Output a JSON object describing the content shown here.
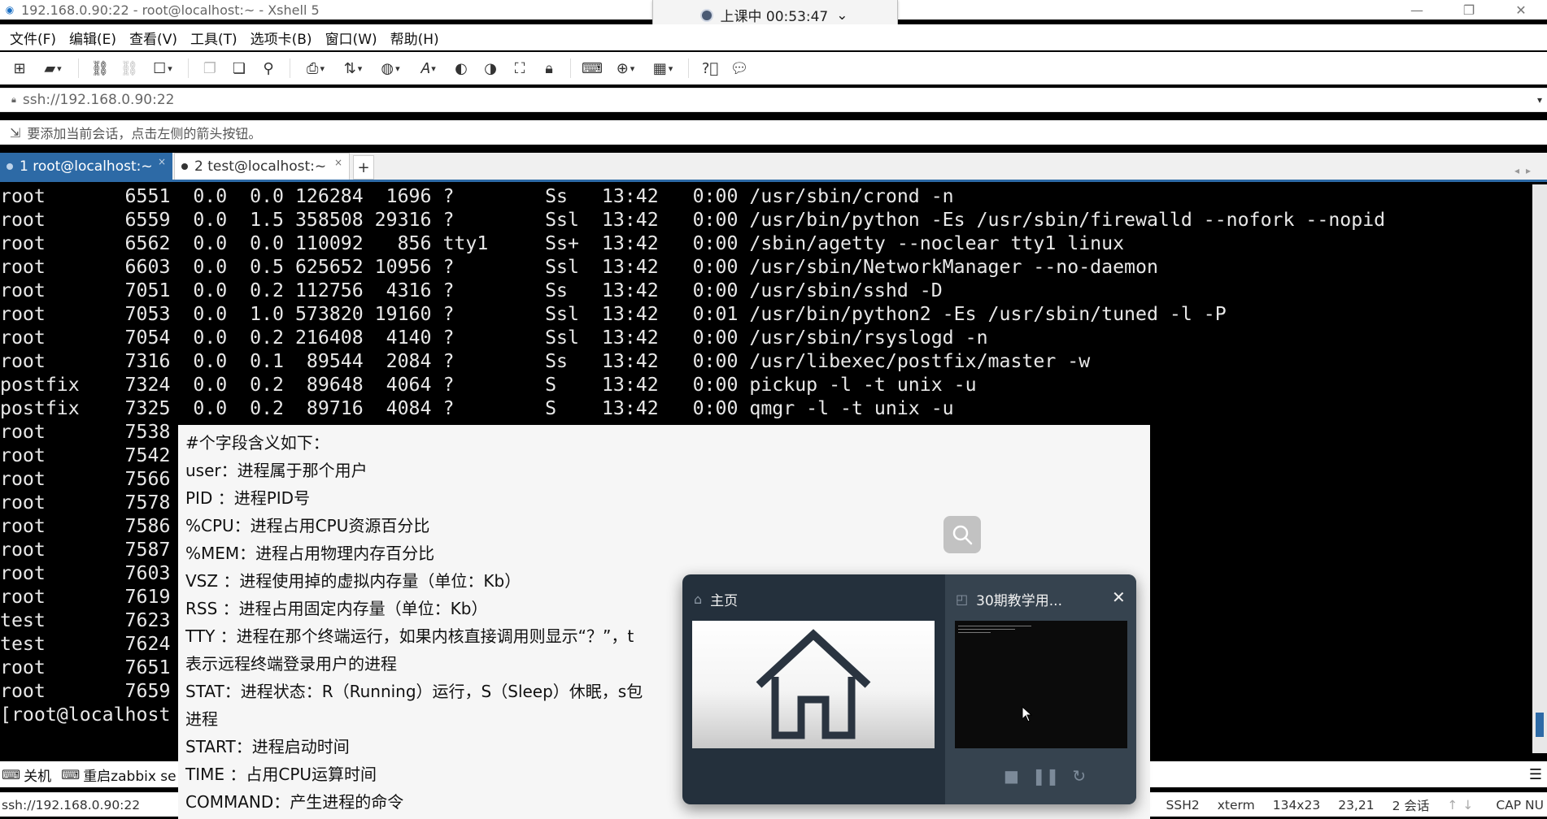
{
  "window": {
    "title": "192.168.0.90:22 - root@localhost:~ - Xshell 5",
    "app_icon": "xshell-app-icon",
    "buttons": [
      "—",
      "❐",
      "✕"
    ]
  },
  "recording": {
    "label": "上课中 00:53:47",
    "chevron": "⌄"
  },
  "menu": [
    "文件(F)",
    "编辑(E)",
    "查看(V)",
    "工具(T)",
    "选项卡(B)",
    "窗口(W)",
    "帮助(H)"
  ],
  "address": {
    "url": "ssh://192.168.0.90:22"
  },
  "hint": {
    "text": "要添加当前会话，点击左侧的箭头按钮。"
  },
  "tabs": [
    {
      "label": "1 root@localhost:~"
    },
    {
      "label": "2 test@localhost:~"
    }
  ],
  "terminal": {
    "lines": [
      "root       6551  0.0  0.0 126284  1696 ?        Ss   13:42   0:00 /usr/sbin/crond -n",
      "root       6559  0.0  1.5 358508 29316 ?        Ssl  13:42   0:00 /usr/bin/python -Es /usr/sbin/firewalld --nofork --nopid",
      "root       6562  0.0  0.0 110092   856 tty1     Ss+  13:42   0:00 /sbin/agetty --noclear tty1 linux",
      "root       6603  0.0  0.5 625652 10956 ?        Ssl  13:42   0:00 /usr/sbin/NetworkManager --no-daemon",
      "root       7051  0.0  0.2 112756  4316 ?        Ss   13:42   0:00 /usr/sbin/sshd -D",
      "root       7053  0.0  1.0 573820 19160 ?        Ssl  13:42   0:01 /usr/bin/python2 -Es /usr/sbin/tuned -l -P",
      "root       7054  0.0  0.2 216408  4140 ?        Ssl  13:42   0:00 /usr/sbin/rsyslogd -n",
      "root       7316  0.0  0.1  89544  2084 ?        Ss   13:42   0:00 /usr/libexec/postfix/master -w",
      "postfix    7324  0.0  0.2  89648  4064 ?        S    13:42   0:00 pickup -l -t unix -u",
      "postfix    7325  0.0  0.2  89716  4084 ?        S    13:42   0:00 qmgr -l -t unix -u",
      "root       7538",
      "root       7542",
      "root       7566",
      "root       7578",
      "root       7586",
      "root       7587",
      "root       7603",
      "root       7619",
      "test       7623",
      "test       7624",
      "root       7651",
      "root       7659",
      "[root@localhost"
    ]
  },
  "quick_commands": [
    {
      "icon": "keyboard-icon",
      "label": "关机"
    },
    {
      "icon": "keyboard-icon",
      "label": "重启zabbix se"
    }
  ],
  "status": {
    "url": "ssh://192.168.0.90:22",
    "protocol": "SSH2",
    "term": "xterm",
    "size": "134x23",
    "cursor": "23,21",
    "sessions": "2 会话",
    "caps": "CAP NU"
  },
  "note": {
    "lines": [
      "#个字段含义如下：",
      "user：进程属于那个用户",
      "PID ：进程PID号",
      "%CPU：进程占用CPU资源百分比",
      "%MEM：进程占用物理内存百分比",
      "VSZ ：进程使用掉的虚拟内存量（单位：Kb）",
      "RSS ：进程占用固定内存量（单位：Kb）",
      "TTY ：进程在那个终端运行，如果内核直接调用则显示“？”，t",
      "表示远程终端登录用户的进程",
      "STAT：进程状态：R（Running）运行，S（Sleep）休眠，s包",
      "进程",
      "START：进程启动时间",
      "TIME ：占用CPU运算时间",
      "COMMAND：产生进程的命令"
    ]
  },
  "switcher": {
    "home_title": "主页",
    "window_title": "30期教学用...",
    "close": "✕"
  }
}
